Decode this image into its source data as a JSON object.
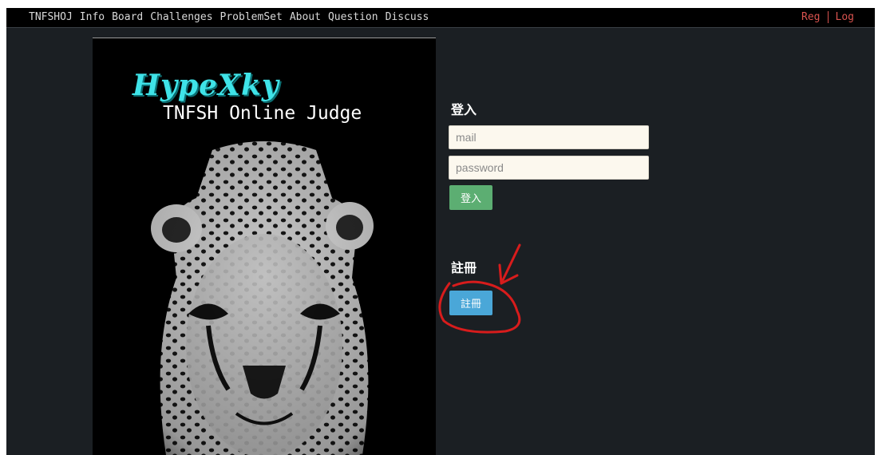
{
  "navbar": {
    "brand": "TNFSHOJ",
    "items": [
      "Info",
      "Board",
      "Challenges",
      "ProblemSet",
      "About",
      "Question",
      "Discuss"
    ],
    "right": {
      "register": "Reg",
      "login": "Log"
    }
  },
  "poster": {
    "logo_text": "HypeXky",
    "subtitle": "TNFSH Online Judge"
  },
  "login": {
    "title": "登入",
    "mail_placeholder": "mail",
    "password_placeholder": "password",
    "button": "登入"
  },
  "register": {
    "title": "註冊",
    "button": "註冊"
  },
  "colors": {
    "page_bg": "#1b1f23",
    "nav_bg": "#000000",
    "logo": "#3fe3e8",
    "login_button": "#5cae72",
    "register_button": "#4aa7d8",
    "annotation": "#d81c1c"
  }
}
